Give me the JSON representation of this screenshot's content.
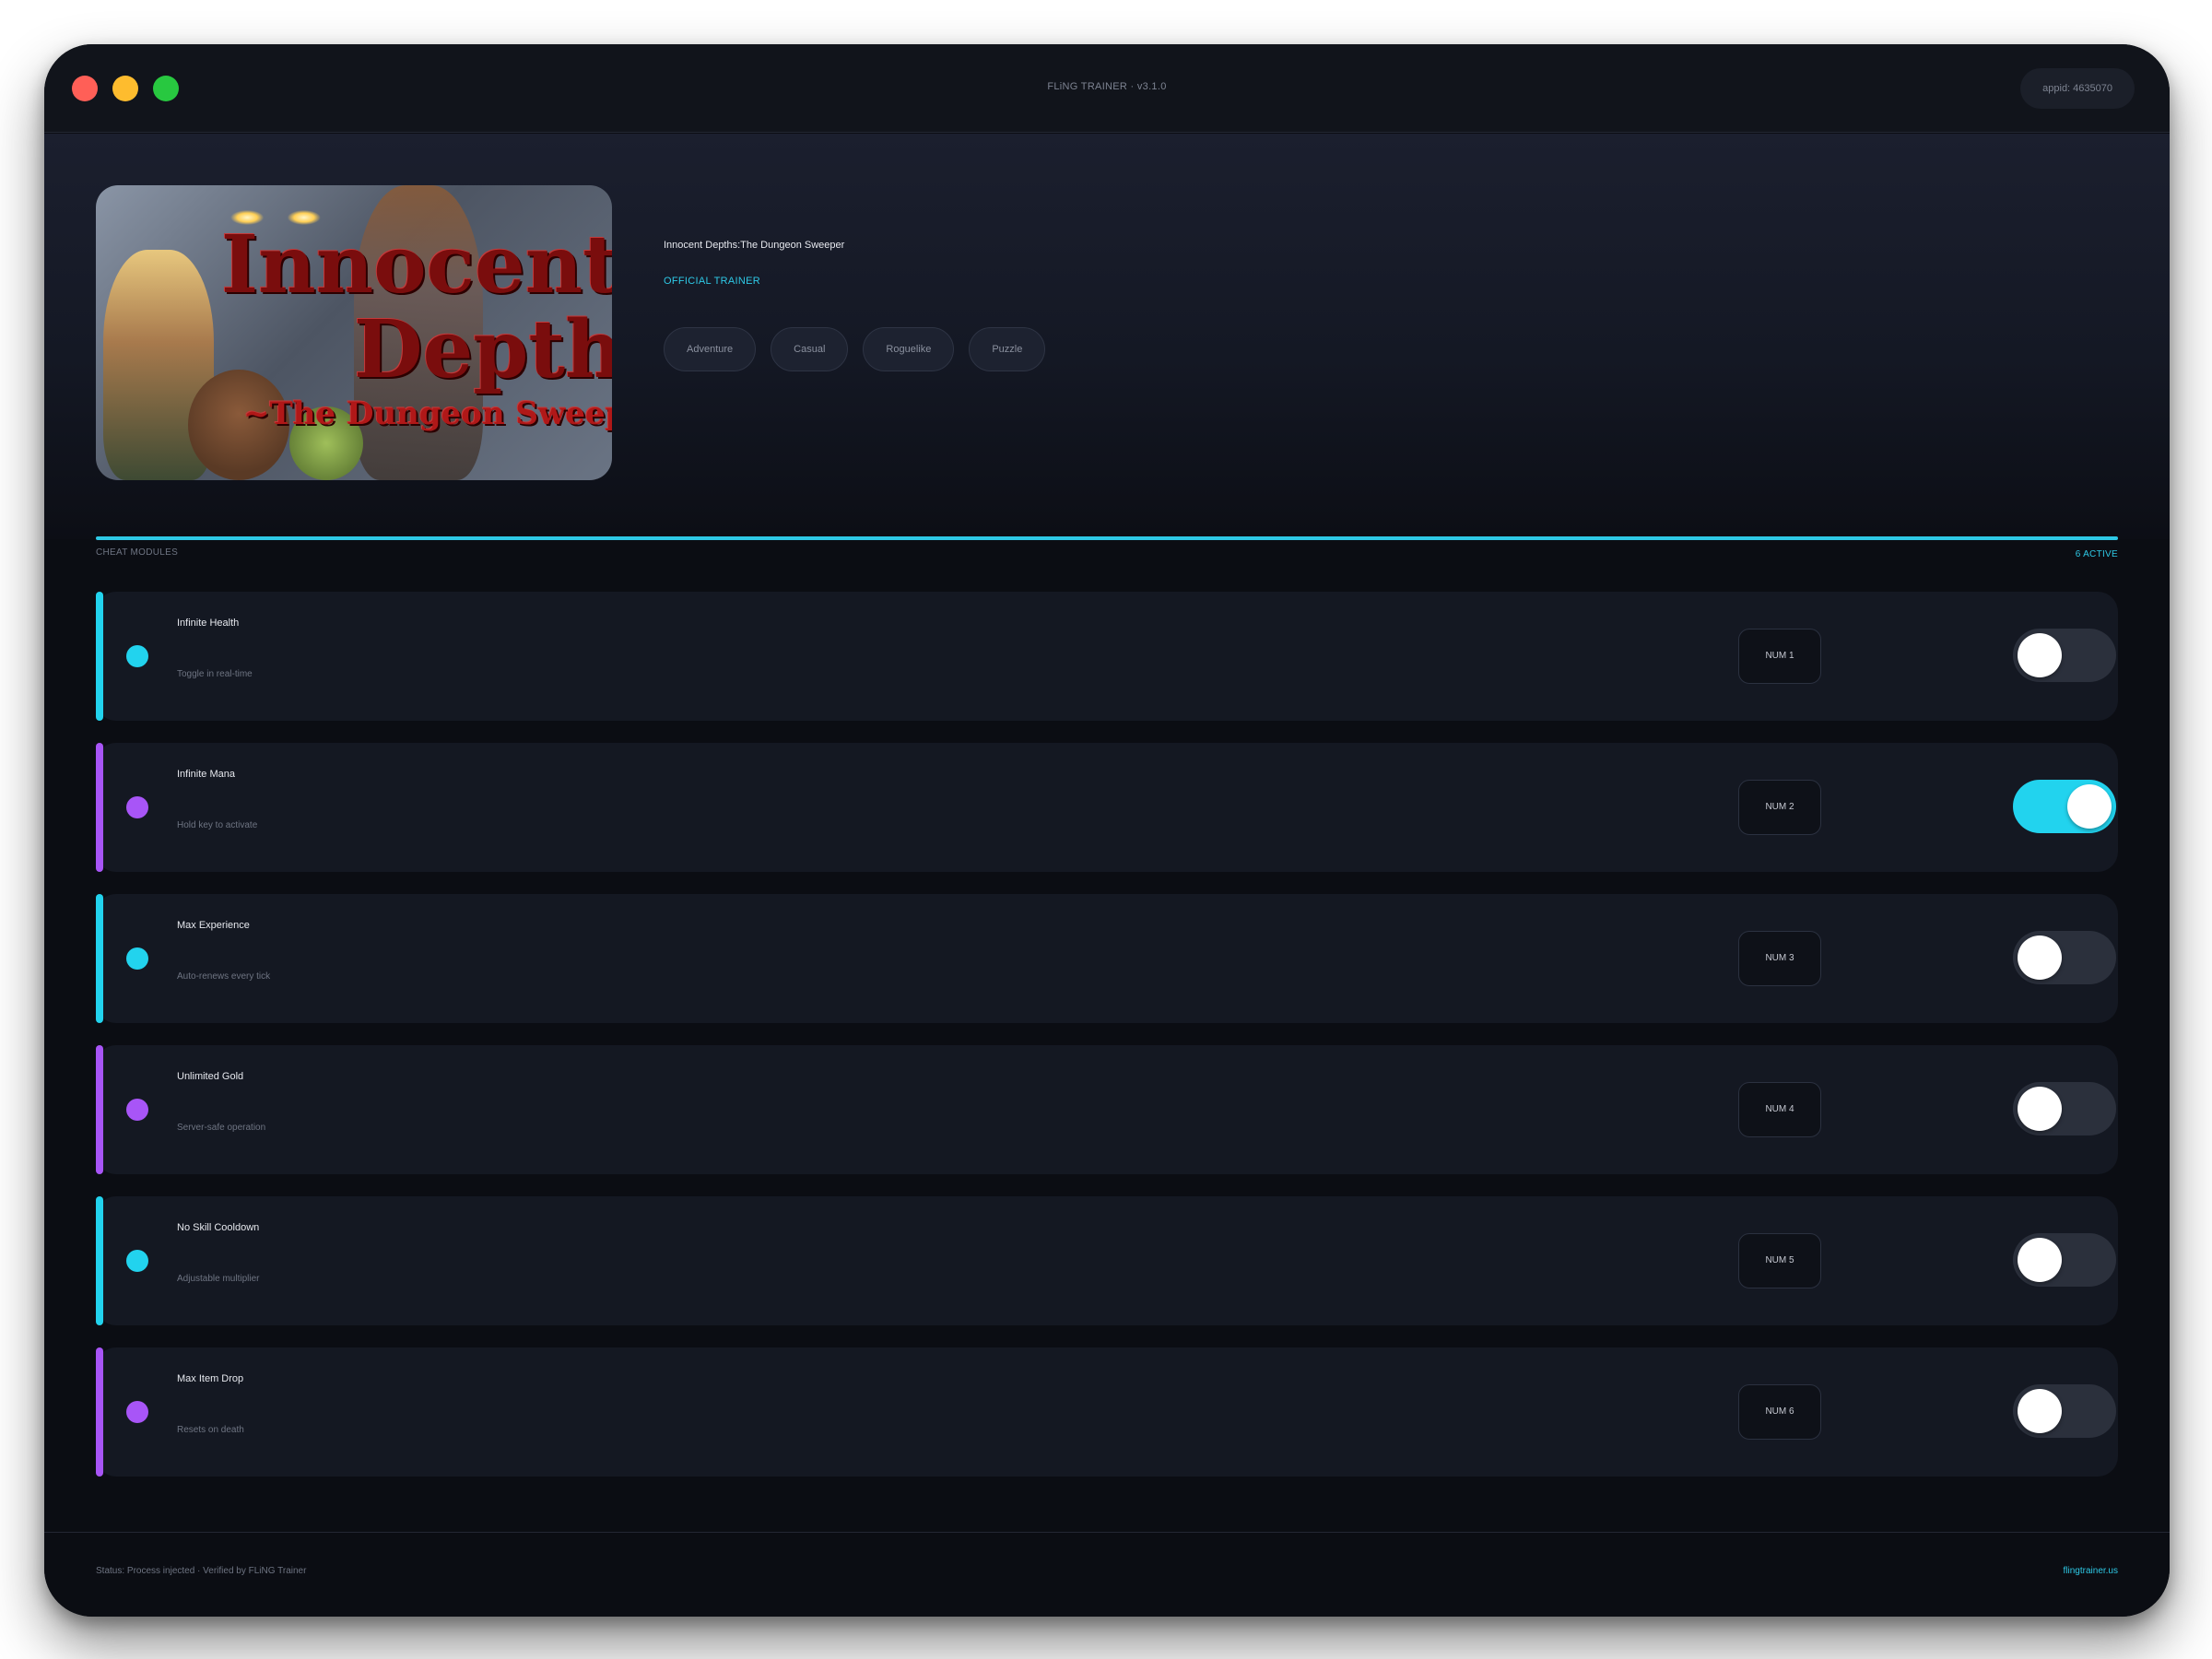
{
  "window": {
    "title": "FLiNG TRAINER · v3.1.0",
    "appid": "appid: 4635070"
  },
  "game": {
    "title": "Innocent Depths:The Dungeon Sweeper",
    "badge": "OFFICIAL TRAINER",
    "cover_text": [
      "Innocent",
      "Depth",
      "~The Dungeon Sweepe"
    ],
    "tags": [
      "Adventure",
      "Casual",
      "Roguelike",
      "Puzzle"
    ]
  },
  "section": {
    "label": "CHEAT MODULES",
    "active_count": "6 ACTIVE"
  },
  "cheats": [
    {
      "name": "Infinite Health",
      "desc": "Toggle in real-time",
      "hotkey": "NUM 1",
      "enabled": false,
      "color": "#22d3ee"
    },
    {
      "name": "Infinite Mana",
      "desc": "Hold key to activate",
      "hotkey": "NUM 2",
      "enabled": true,
      "color": "#a855f7"
    },
    {
      "name": "Max Experience",
      "desc": "Auto-renews every tick",
      "hotkey": "NUM 3",
      "enabled": false,
      "color": "#22d3ee"
    },
    {
      "name": "Unlimited Gold",
      "desc": "Server-safe operation",
      "hotkey": "NUM 4",
      "enabled": false,
      "color": "#a855f7"
    },
    {
      "name": "No Skill Cooldown",
      "desc": "Adjustable multiplier",
      "hotkey": "NUM 5",
      "enabled": false,
      "color": "#22d3ee"
    },
    {
      "name": "Max Item Drop",
      "desc": "Resets on death",
      "hotkey": "NUM 6",
      "enabled": false,
      "color": "#a855f7"
    }
  ],
  "footer": {
    "status": "Status: Process injected · Verified by FLiNG Trainer",
    "link": "flingtrainer.us"
  },
  "colors": {
    "accent_cyan": "#22d3ee",
    "accent_purple": "#a855f7",
    "background": "#0b0d13",
    "row_background": "#141822"
  }
}
